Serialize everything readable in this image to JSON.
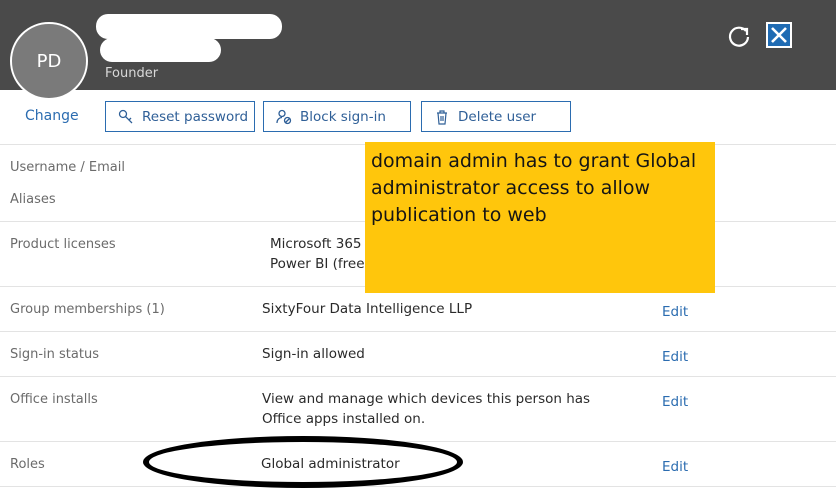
{
  "header": {
    "initials": "PD",
    "job_title": "Founder"
  },
  "actions": {
    "change": "Change",
    "reset_password": "Reset password",
    "block_signin": "Block sign-in",
    "delete_user": "Delete user"
  },
  "rows": {
    "username_label": "Username / Email",
    "aliases_label": "Aliases",
    "licenses_label": "Product licenses",
    "license_1": "Microsoft 365",
    "license_2": "Power BI (free)",
    "groups_label": "Group memberships (1)",
    "groups_value": "SixtyFour Data Intelligence LLP",
    "signin_label": "Sign-in status",
    "signin_value": "Sign-in allowed",
    "office_label": "Office installs",
    "office_value_1": "View and manage which devices this person has",
    "office_value_2": "Office apps installed on.",
    "roles_label": "Roles",
    "roles_value": "Global administrator",
    "edit": "Edit"
  },
  "annotation": {
    "note": "domain admin has to grant Global administrator access to allow publication to web"
  }
}
